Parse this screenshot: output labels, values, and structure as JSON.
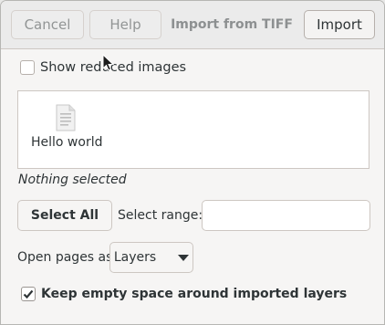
{
  "header": {
    "cancel_label": "Cancel",
    "help_label": "Help",
    "title": "Import from TIFF",
    "import_label": "Import"
  },
  "show_reduced": {
    "label": "Show reduced images",
    "checked": false
  },
  "pages": [
    {
      "label": "Hello world",
      "icon": "document-page-icon"
    }
  ],
  "selection_status": "Nothing selected",
  "select_all_label": "Select All",
  "select_range": {
    "label": "Select range:",
    "value": ""
  },
  "open_pages": {
    "label": "Open pages as",
    "selected": "Layers"
  },
  "keep_empty_space": {
    "label": "Keep empty space around imported layers",
    "checked": true
  }
}
